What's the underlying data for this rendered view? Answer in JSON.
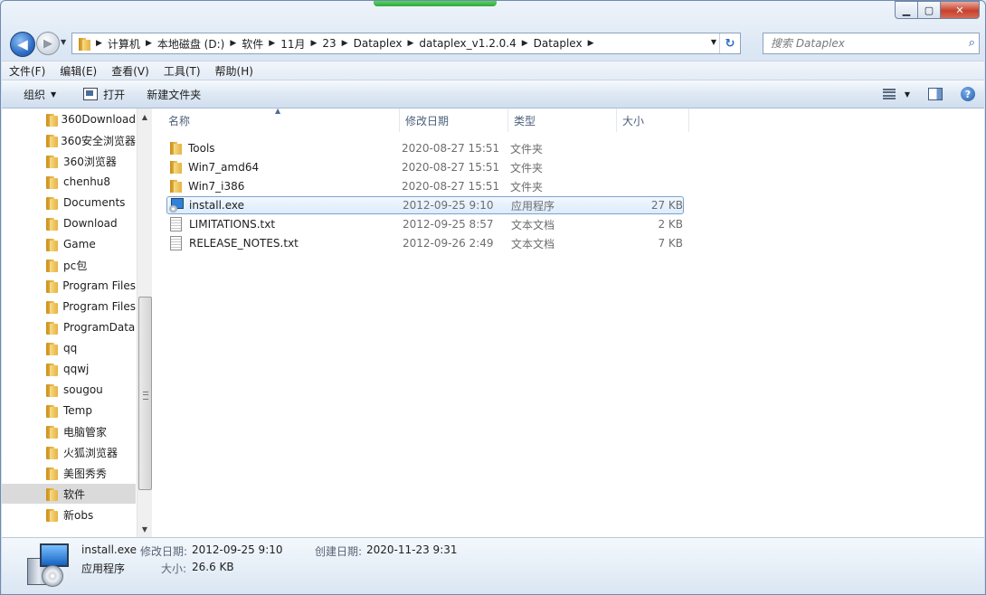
{
  "window": {
    "controls": {
      "minimize": "▁",
      "maximize": "▢",
      "close": "✕"
    }
  },
  "nav": {
    "back": "◀",
    "forward": "▶",
    "recent": "▼"
  },
  "address": {
    "crumbs": [
      "计算机",
      "本地磁盘 (D:)",
      "软件",
      "11月",
      "23",
      "Dataplex",
      "dataplex_v1.2.0.4",
      "Dataplex"
    ],
    "separator": "▶",
    "dropdown": "▼",
    "refresh": "↻"
  },
  "search": {
    "placeholder": "搜索 Dataplex",
    "icon": "search-icon"
  },
  "menu": [
    "文件(F)",
    "编辑(E)",
    "查看(V)",
    "工具(T)",
    "帮助(H)"
  ],
  "commands": {
    "organize": "组织",
    "open": "打开",
    "new_folder": "新建文件夹",
    "help": "?"
  },
  "tree": {
    "items": [
      "360Download",
      "360安全浏览器",
      "360浏览器",
      "chenhu8",
      "Documents",
      "Download",
      "Game",
      "pc包",
      "Program Files",
      "Program Files",
      "ProgramData",
      "qq",
      "qqwj",
      "sougou",
      "Temp",
      "电脑管家",
      "火狐浏览器",
      "美图秀秀",
      "软件",
      "新obs"
    ],
    "selected": "软件"
  },
  "columns": {
    "name": "名称",
    "date": "修改日期",
    "type": "类型",
    "size": "大小"
  },
  "files": [
    {
      "name": "Tools",
      "date": "2020-08-27 15:51",
      "type": "文件夹",
      "size": "",
      "icon": "folder-icon"
    },
    {
      "name": "Win7_amd64",
      "date": "2020-08-27 15:51",
      "type": "文件夹",
      "size": "",
      "icon": "folder-icon"
    },
    {
      "name": "Win7_i386",
      "date": "2020-08-27 15:51",
      "type": "文件夹",
      "size": "",
      "icon": "folder-icon"
    },
    {
      "name": "install.exe",
      "date": "2012-09-25 9:10",
      "type": "应用程序",
      "size": "27 KB",
      "icon": "installer-icon",
      "selected": true
    },
    {
      "name": "LIMITATIONS.txt",
      "date": "2012-09-25 8:57",
      "type": "文本文档",
      "size": "2 KB",
      "icon": "text-file-icon"
    },
    {
      "name": "RELEASE_NOTES.txt",
      "date": "2012-09-26 2:49",
      "type": "文本文档",
      "size": "7 KB",
      "icon": "text-file-icon"
    }
  ],
  "details": {
    "name": "install.exe",
    "kind": "应用程序",
    "modified_label": "修改日期:",
    "modified": "2012-09-25 9:10",
    "created_label": "创建日期:",
    "created": "2020-11-23 9:31",
    "size_label": "大小:",
    "size": "26.6 KB"
  }
}
